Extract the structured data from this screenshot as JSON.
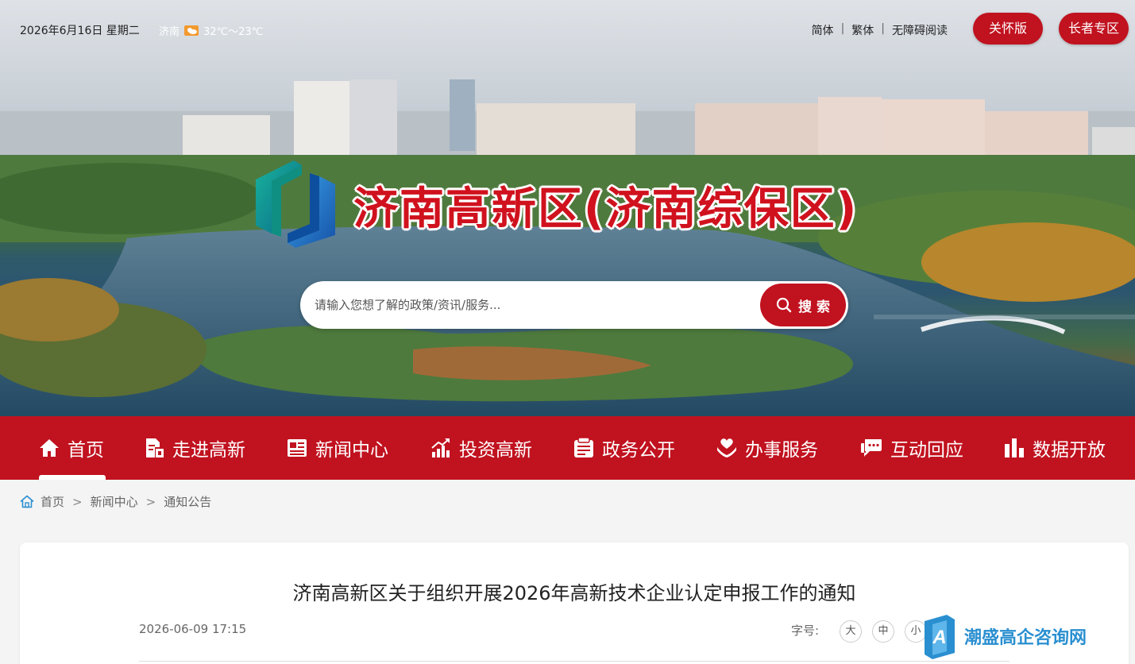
{
  "topbar": {
    "date": "2026年6月16日 星期二",
    "weather_city": "济南",
    "weather_temp": "32℃～23℃",
    "lang_simplified": "简体",
    "lang_traditional": "繁体",
    "accessible_reading": "无障碍阅读",
    "care_mode": "关怀版",
    "elder_mode": "长者专区"
  },
  "site": {
    "title": "济南高新区(济南综保区)"
  },
  "search": {
    "placeholder": "请输入您想了解的政策/资讯/服务...",
    "button_label": "搜 索"
  },
  "nav": {
    "items": [
      {
        "label": "首页",
        "icon": "home-icon",
        "active": true
      },
      {
        "label": "走进高新",
        "icon": "document-building-icon"
      },
      {
        "label": "新闻中心",
        "icon": "newspaper-icon"
      },
      {
        "label": "投资高新",
        "icon": "growth-chart-icon"
      },
      {
        "label": "政务公开",
        "icon": "list-document-icon"
      },
      {
        "label": "办事服务",
        "icon": "heart-hands-icon"
      },
      {
        "label": "互动回应",
        "icon": "chat-bubble-icon"
      },
      {
        "label": "数据开放",
        "icon": "bar-chart-icon"
      }
    ]
  },
  "breadcrumb": {
    "home": "首页",
    "level1": "新闻中心",
    "level2": "通知公告",
    "separator": ">"
  },
  "article": {
    "title": "济南高新区关于组织开展2026年高新技术企业认定申报工作的通知",
    "date": "2026-06-09 17:15",
    "font_size_label": "字号:",
    "font_large": "大",
    "font_medium": "中",
    "font_small": "小"
  },
  "watermark": {
    "text": "潮盛高企咨询网"
  },
  "colors": {
    "brand_red": "#c1121f",
    "title_red": "#d0121e",
    "watermark_blue": "#2a8fd0"
  }
}
